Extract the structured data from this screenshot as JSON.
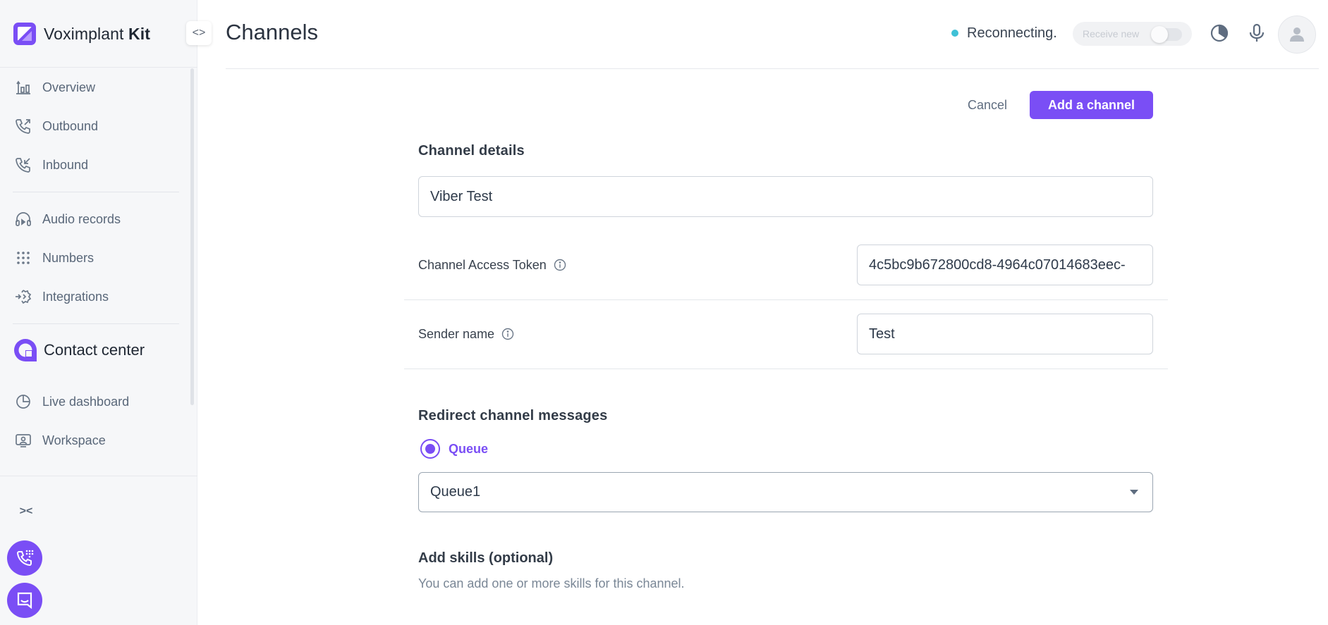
{
  "brand": {
    "name_regular": "Voximplant",
    "name_bold": "Kit"
  },
  "colors": {
    "accent": "#7a4ef5",
    "status_dot": "#3fc1d6",
    "sidebar_bg": "#f6f7f9"
  },
  "sidebar": {
    "items": [
      {
        "label": "Overview",
        "icon": "chart-icon"
      },
      {
        "label": "Outbound",
        "icon": "outbound-call-icon"
      },
      {
        "label": "Inbound",
        "icon": "inbound-call-icon"
      },
      {
        "label": "Audio records",
        "icon": "headphones-icon"
      },
      {
        "label": "Numbers",
        "icon": "dialpad-icon"
      },
      {
        "label": "Integrations",
        "icon": "integrations-icon"
      },
      {
        "label": "Live dashboard",
        "icon": "pie-chart-icon"
      },
      {
        "label": "Workspace",
        "icon": "workspace-icon"
      }
    ],
    "section_title": "Contact center"
  },
  "header": {
    "title": "Channels",
    "status": "Reconnecting.",
    "receive_label": "Receive new"
  },
  "actions": {
    "cancel": "Cancel",
    "add": "Add a channel"
  },
  "form": {
    "details_title": "Channel details",
    "channel_name": "Viber Test",
    "access_token_label": "Channel Access Token",
    "access_token_value": "4c5bc9b672800cd8-4964c07014683eec-",
    "sender_label": "Sender name",
    "sender_value": "Test",
    "redirect_title": "Redirect channel messages",
    "radio_label": "Queue",
    "queue_selected": "Queue1",
    "skills_title": "Add skills (optional)",
    "skills_desc": "You can add one or more skills for this channel."
  }
}
